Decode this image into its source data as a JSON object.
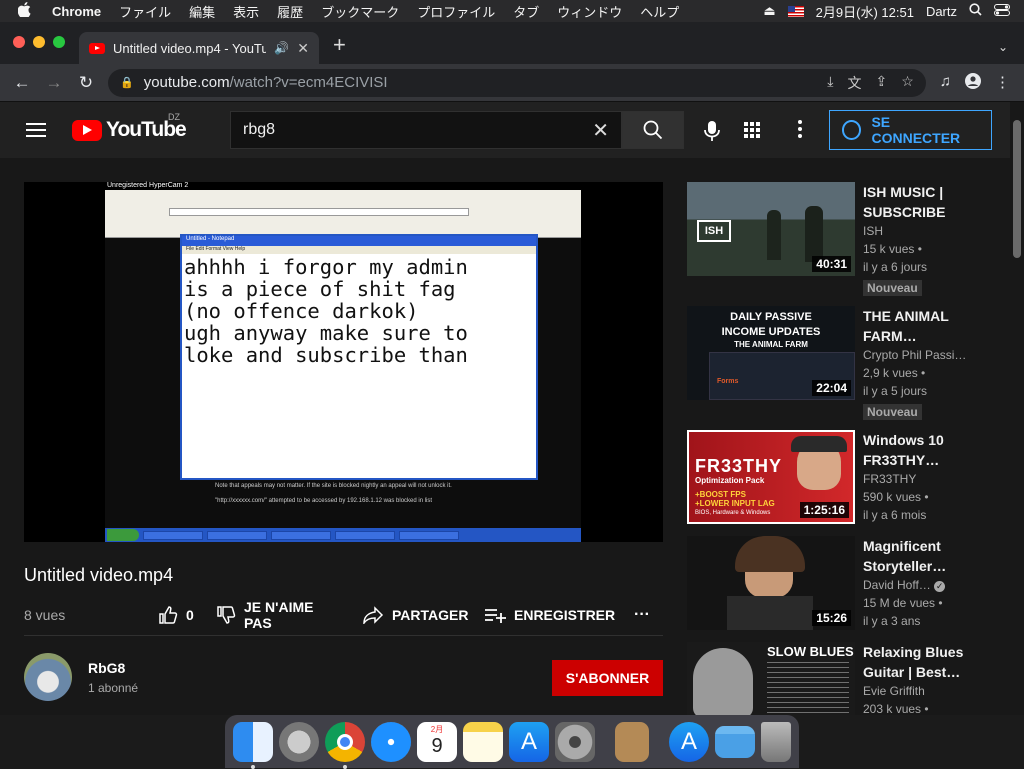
{
  "menubar": {
    "apple": "",
    "app": "Chrome",
    "items": [
      "ファイル",
      "編集",
      "表示",
      "履歴",
      "ブックマーク",
      "プロファイル",
      "タブ",
      "ウィンドウ",
      "ヘルプ"
    ],
    "datetime": "2月9日(水) 12:51",
    "user": "Dartz"
  },
  "tab": {
    "title": "Untitled video.mp4 - YouTube"
  },
  "toolbar": {
    "url_host": "youtube.com",
    "url_path": "/watch?v=ecm4ECIVISI"
  },
  "youtube": {
    "logo": "YouTube",
    "country": "DZ",
    "search_value": "rbg8",
    "signin_label": "SE CONNECTER"
  },
  "video": {
    "title": "Untitled video.mp4",
    "views": "8 vues",
    "likes": "0",
    "dislike_label": "JE N'AIME PAS",
    "share_label": "PARTAGER",
    "save_label": "ENREGISTRER",
    "more": "···",
    "screen": {
      "cam_caption": "Unregistered HyperCam 2",
      "notepad_title": "Untitled - Notepad",
      "notepad_menu": "File  Edit  Format  View  Help",
      "notepad_text": "ahhhh i forgor my admin\nis a piece of shit fag\n(no offence darkok)\nugh anyway make sure to\nloke and subscribe than",
      "below_text": "Note that appeals may not matter. If the site is blocked nightly an appeal will not unlock it.",
      "below_text2": "\"http://xxxxxx.com/\" attempted to be accessed by 192.168.1.12 was blocked in list"
    }
  },
  "channel": {
    "name": "RbG8",
    "subs": "1 abonné",
    "subscribe_label": "S'ABONNER"
  },
  "recommendations": [
    {
      "title": "ISH MUSIC |\nSUBSCRIBE",
      "channel": "ISH",
      "views": "15 k vues •",
      "age": "il y a 6 jours",
      "badge": "Nouveau",
      "duration": "40:31",
      "thumb_text": "ISH"
    },
    {
      "title": "THE ANIMAL\nFARM…",
      "channel": "Crypto Phil Passi…",
      "views": "2,9 k vues •",
      "age": "il y a 5 jours",
      "badge": "Nouveau",
      "duration": "22:04",
      "thumb_text": "DAILY PASSIVE\nINCOME UPDATES",
      "thumb_sub": "THE ANIMAL FARM",
      "thumb_label": "Forms"
    },
    {
      "title": "Windows 10\nFR33THY…",
      "channel": "FR33THY",
      "views": "590 k vues •",
      "age": "il y a 6 mois",
      "badge": "",
      "duration": "1:25:16",
      "thumb_text": "FR33THY",
      "thumb_sub": "Optimization Pack",
      "thumb_lines": "+BOOST FPS\n+LOWER INPUT LAG",
      "thumb_foot": "BIOS, Hardware & Windows"
    },
    {
      "title": "Magnificent\nStoryteller…",
      "channel": "David Hoff…",
      "views": "15 M de vues •",
      "age": "il y a 3 ans",
      "badge": "",
      "duration": "15:26"
    },
    {
      "title": "Relaxing Blues\nGuitar | Best…",
      "channel": "Evie Griffith",
      "views": "203 k vues •",
      "age": "",
      "badge": "",
      "duration": "",
      "thumb_text": "SLOW BLUES"
    }
  ],
  "colors": {
    "accent_red": "#ff0000",
    "subscribe_red": "#cc0000",
    "link_blue": "#3ea6ff"
  },
  "dock": [
    "finder-icon",
    "launchpad-icon",
    "chrome-icon",
    "safari-icon",
    "calendar-icon",
    "notes-icon",
    "appstore-icon",
    "system-preferences-icon",
    "archive-icon",
    "appstore-icon",
    "folder-icon",
    "trash-icon"
  ],
  "dock_calendar": {
    "month": "2月",
    "day": "9"
  }
}
